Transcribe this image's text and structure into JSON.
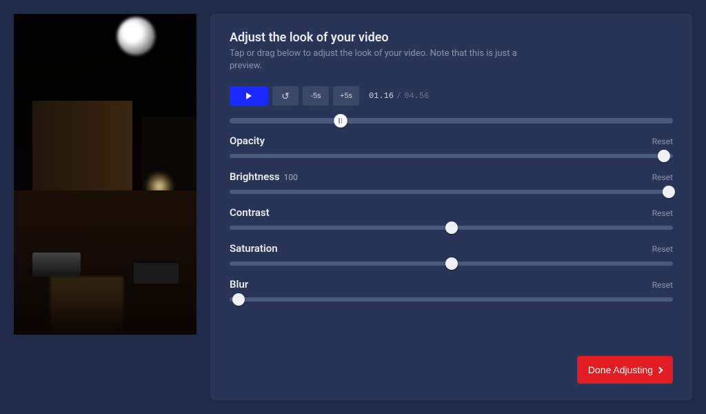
{
  "header": {
    "title": "Adjust the look of your video",
    "subtitle": "Tap or drag below to adjust the look of your video. Note that this is just a preview."
  },
  "transport": {
    "play_label": "Play",
    "rewind_label": "Rewind",
    "minus5_label": "-5s",
    "plus5_label": "+5s",
    "current_time": "01.16",
    "total_time": "04.56",
    "scrub_percent": 25
  },
  "params": [
    {
      "key": "opacity",
      "label": "Opacity",
      "value": null,
      "percent": 98,
      "reset": "Reset"
    },
    {
      "key": "brightness",
      "label": "Brightness",
      "value": "100",
      "percent": 99,
      "reset": "Reset"
    },
    {
      "key": "contrast",
      "label": "Contrast",
      "value": null,
      "percent": 50,
      "reset": "Reset"
    },
    {
      "key": "saturation",
      "label": "Saturation",
      "value": null,
      "percent": 50,
      "reset": "Reset"
    },
    {
      "key": "blur",
      "label": "Blur",
      "value": null,
      "percent": 2,
      "reset": "Reset"
    }
  ],
  "footer": {
    "done_label": "Done Adjusting"
  }
}
